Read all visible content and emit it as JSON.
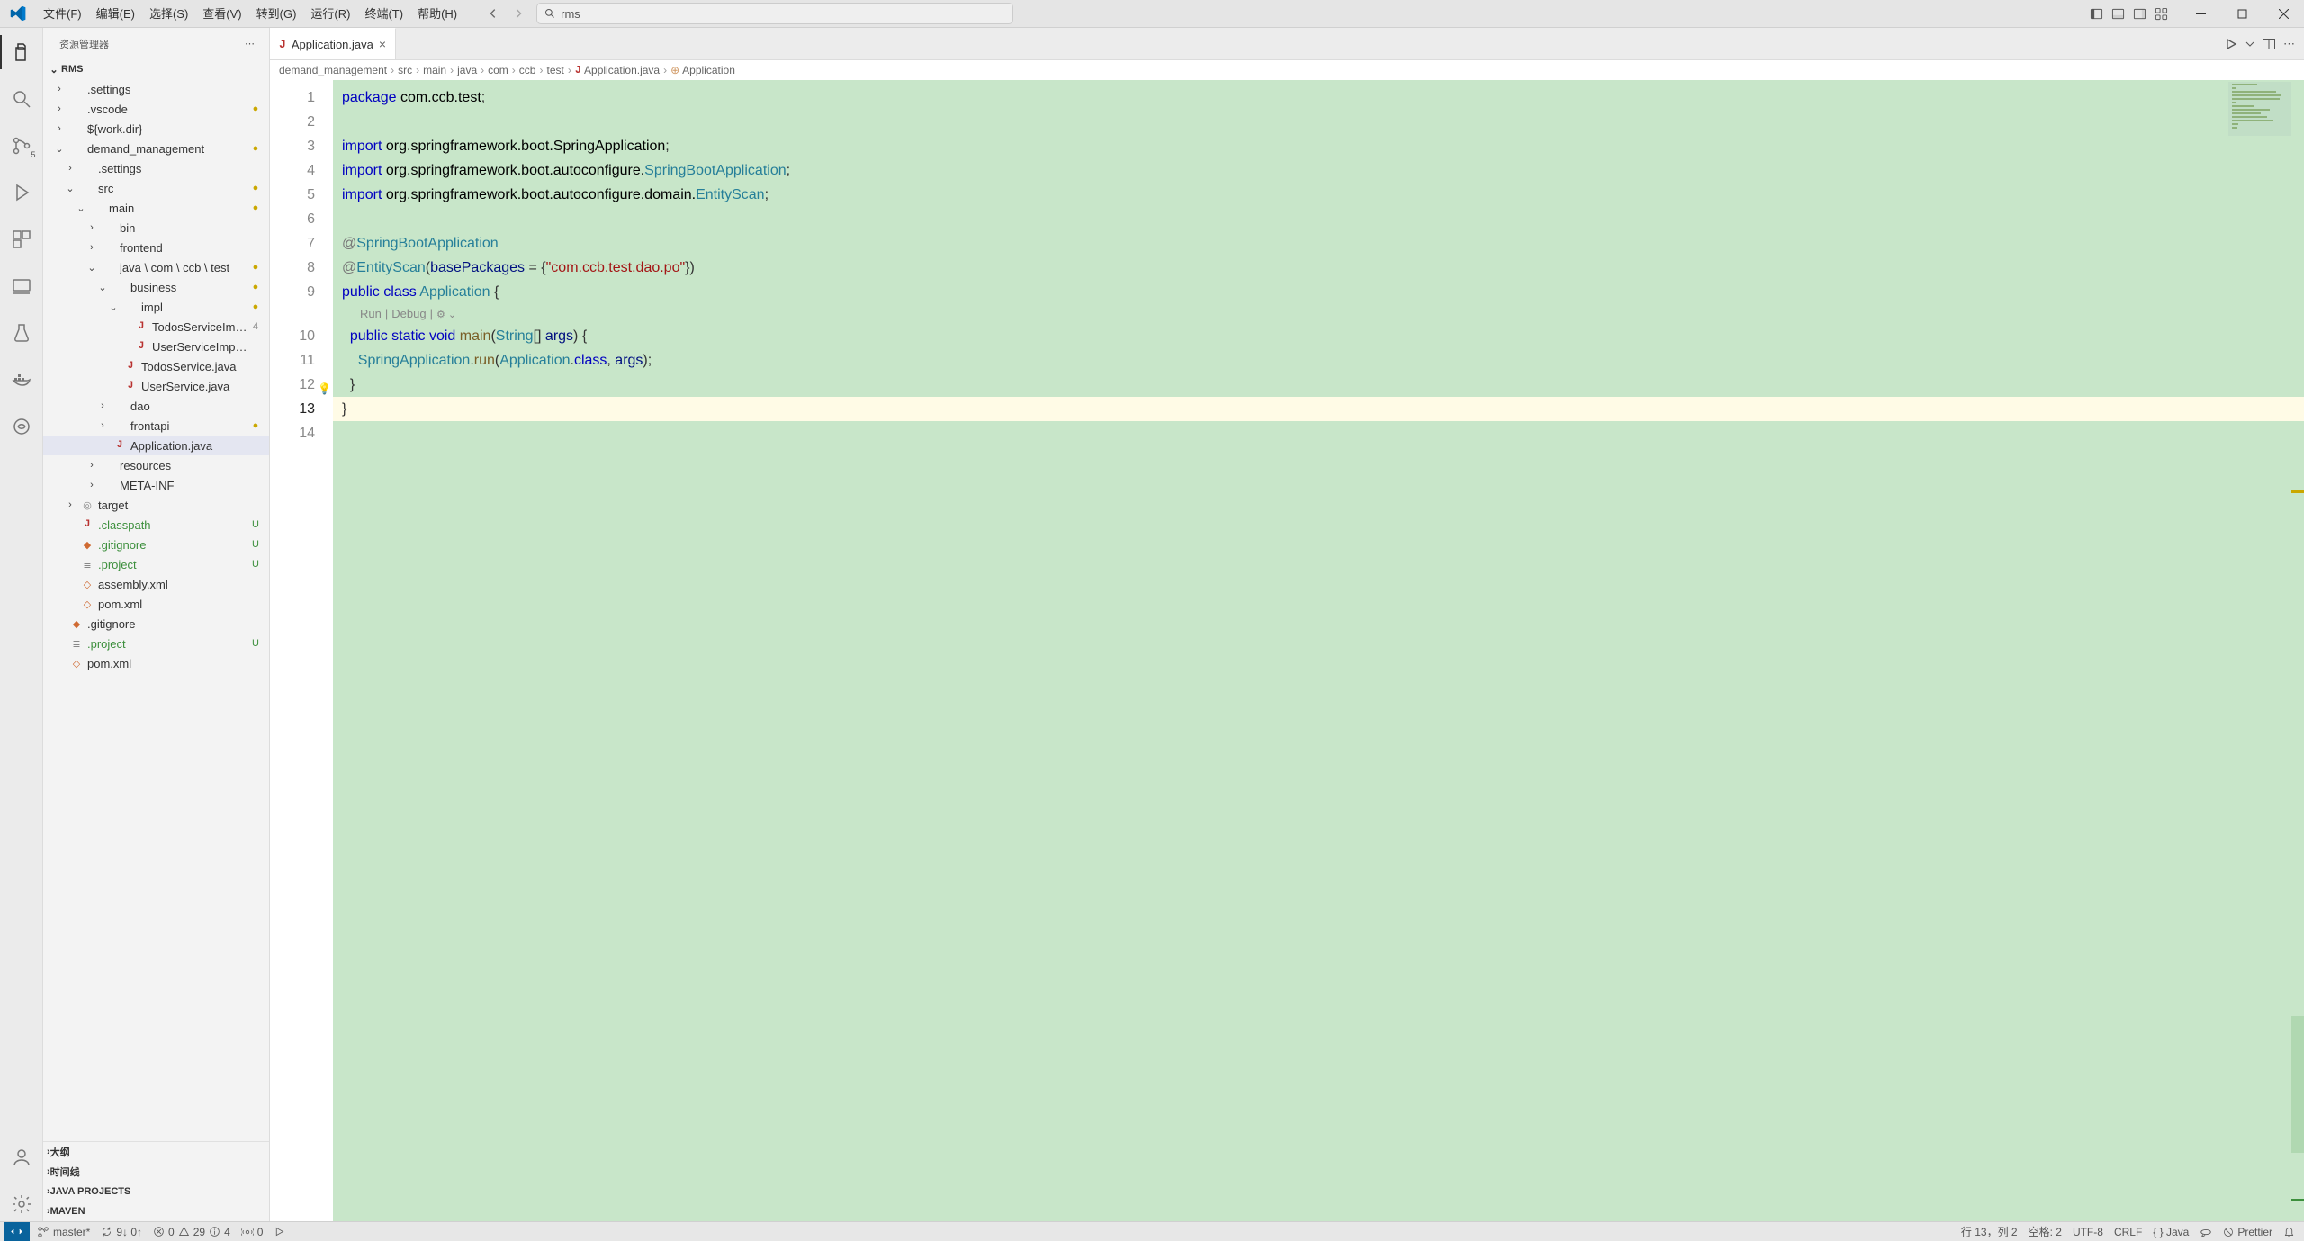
{
  "menu": [
    "文件(F)",
    "编辑(E)",
    "选择(S)",
    "查看(V)",
    "转到(G)",
    "运行(R)",
    "终端(T)",
    "帮助(H)"
  ],
  "search_value": "rms",
  "sidebar_title": "资源管理器",
  "project_name": "RMS",
  "tree": [
    {
      "d": 0,
      "t": "c",
      "k": "folder",
      "n": ".settings"
    },
    {
      "d": 0,
      "t": "c",
      "k": "folder",
      "n": ".vscode",
      "dot": true
    },
    {
      "d": 0,
      "t": "c",
      "k": "folder",
      "n": "${work.dir}"
    },
    {
      "d": 0,
      "t": "e",
      "k": "folder",
      "n": "demand_management",
      "dot": true
    },
    {
      "d": 1,
      "t": "c",
      "k": "folder",
      "n": ".settings"
    },
    {
      "d": 1,
      "t": "e",
      "k": "folder",
      "n": "src",
      "dot": true
    },
    {
      "d": 2,
      "t": "e",
      "k": "folder",
      "n": "main",
      "dot": true
    },
    {
      "d": 3,
      "t": "c",
      "k": "folder",
      "n": "bin"
    },
    {
      "d": 3,
      "t": "c",
      "k": "folder",
      "n": "frontend"
    },
    {
      "d": 3,
      "t": "e",
      "k": "folder",
      "n": "java \\ com \\ ccb \\ test",
      "dot": true
    },
    {
      "d": 4,
      "t": "e",
      "k": "folder",
      "n": "business",
      "dot": true
    },
    {
      "d": 5,
      "t": "e",
      "k": "folder",
      "n": "impl",
      "dot": true
    },
    {
      "d": 6,
      "t": "f",
      "k": "java",
      "n": "TodosServiceImpl.java",
      "status": "4"
    },
    {
      "d": 6,
      "t": "f",
      "k": "java",
      "n": "UserServiceImpl.java"
    },
    {
      "d": 5,
      "t": "f",
      "k": "java",
      "n": "TodosService.java"
    },
    {
      "d": 5,
      "t": "f",
      "k": "java",
      "n": "UserService.java"
    },
    {
      "d": 4,
      "t": "c",
      "k": "folder",
      "n": "dao"
    },
    {
      "d": 4,
      "t": "c",
      "k": "folder",
      "n": "frontapi",
      "dot": true
    },
    {
      "d": 4,
      "t": "f",
      "k": "java",
      "n": "Application.java",
      "selected": true
    },
    {
      "d": 3,
      "t": "c",
      "k": "folder",
      "n": "resources"
    },
    {
      "d": 3,
      "t": "c",
      "k": "folder",
      "n": "META-INF"
    },
    {
      "d": 1,
      "t": "c",
      "k": "target",
      "n": "target"
    },
    {
      "d": 1,
      "t": "f",
      "k": "java",
      "n": ".classpath",
      "git": "U"
    },
    {
      "d": 1,
      "t": "f",
      "k": "git",
      "n": ".gitignore",
      "git": "U"
    },
    {
      "d": 1,
      "t": "f",
      "k": "project",
      "n": ".project",
      "git": "U"
    },
    {
      "d": 1,
      "t": "f",
      "k": "xml",
      "n": "assembly.xml"
    },
    {
      "d": 1,
      "t": "f",
      "k": "xml",
      "n": "pom.xml"
    },
    {
      "d": 0,
      "t": "f",
      "k": "git",
      "n": ".gitignore"
    },
    {
      "d": 0,
      "t": "f",
      "k": "project",
      "n": ".project",
      "git": "U"
    },
    {
      "d": 0,
      "t": "f",
      "k": "xml",
      "n": "pom.xml"
    }
  ],
  "side_panels": [
    "大纲",
    "时间线",
    "JAVA PROJECTS",
    "MAVEN"
  ],
  "tab": {
    "icon": "J",
    "name": "Application.java"
  },
  "breadcrumbs": [
    "demand_management",
    "src",
    "main",
    "java",
    "com",
    "ccb",
    "test"
  ],
  "breadcrumb_file": "Application.java",
  "breadcrumb_symbol": "Application",
  "codelens": {
    "run": "Run",
    "debug": "Debug"
  },
  "code": {
    "package": "package",
    "pkg_name": "com.ccb.test",
    "import": "import",
    "i1": "org.springframework.boot.SpringApplication",
    "i2a": "org.springframework.boot.autoconfigure.",
    "i2b": "SpringBootApplication",
    "i3a": "org.springframework.boot.autoconfigure.domain.",
    "i3b": "EntityScan",
    "ann1": "SpringBootApplication",
    "ann2": "EntityScan",
    "ann2_param": "basePackages",
    "ann2_val": "\"com.ccb.test.dao.po\"",
    "public": "public",
    "class": "class",
    "cls": "Application",
    "static": "static",
    "void": "void",
    "main": "main",
    "String": "String",
    "args": "args",
    "SpringApplication": "SpringApplication",
    "run": "run",
    "Application": "Application",
    "classkw": "class"
  },
  "status": {
    "branch": "master*",
    "sync": "9↓ 0↑",
    "errors": "0",
    "warnings": "29",
    "info": "4",
    "ports": "0",
    "cursor": "行 13，列 2",
    "spaces": "空格: 2",
    "encoding": "UTF-8",
    "eol": "CRLF",
    "lang": "{ } Java",
    "prettier": "Prettier"
  }
}
